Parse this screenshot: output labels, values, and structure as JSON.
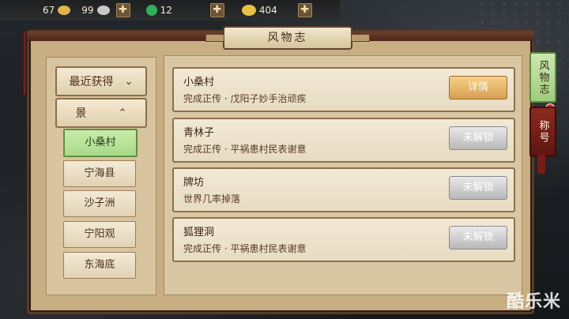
{
  "resources": [
    {
      "icon": "gold-ingot-icon",
      "value": "67"
    },
    {
      "icon": "silver-ingot-icon",
      "value": "99"
    },
    {
      "icon": "jade-icon",
      "value": "12"
    },
    {
      "icon": "gold-coin-icon",
      "value": "404"
    }
  ],
  "title": "风物志",
  "sidebar": {
    "recent_label": "最近获得",
    "category_label": "景",
    "items": [
      "小桑村",
      "宁海县",
      "沙子洲",
      "宁阳观",
      "东海底"
    ]
  },
  "list": [
    {
      "name": "小桑村",
      "desc": "完成正传 · 戊阳子妙手治顽疾",
      "button": "详情",
      "state": "detail"
    },
    {
      "name": "青林子",
      "desc": "完成正传 · 平祸患村民表谢意",
      "button": "未解锁",
      "state": "locked"
    },
    {
      "name": "牌坊",
      "desc": "世界几率掉落",
      "button": "未解锁",
      "state": "locked"
    },
    {
      "name": "狐狸洞",
      "desc": "完成正传 · 平祸患村民表谢意",
      "button": "未解锁",
      "state": "locked"
    }
  ],
  "tabs": [
    "风物志",
    "称号"
  ],
  "watermark": "酷乐米",
  "colors": {
    "accent_green": "#a9d98a",
    "detail_orange": "#d9a052",
    "locked_gray": "#b8b8b8",
    "frame_brown": "#5a3b27"
  }
}
